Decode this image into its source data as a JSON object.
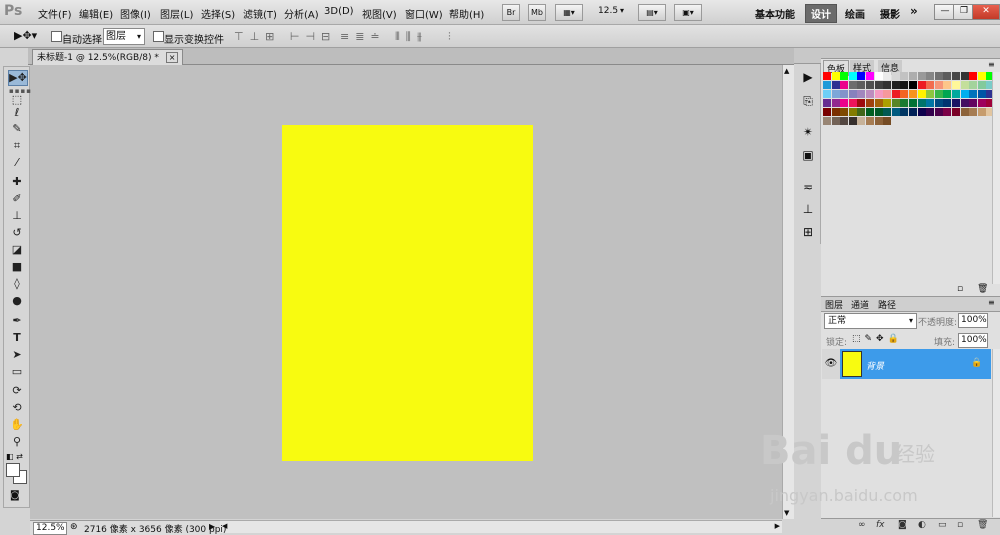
{
  "app": {
    "logo": "Ps"
  },
  "menu": [
    "文件(F)",
    "编辑(E)",
    "图像(I)",
    "图层(L)",
    "选择(S)",
    "滤镜(T)",
    "分析(A)",
    "3D(D)",
    "视图(V)",
    "窗口(W)",
    "帮助(H)"
  ],
  "menu_buttons": {
    "bridge": "Br",
    "minibridge": "Mb",
    "zoom_value": "12.5"
  },
  "workspaces": {
    "essentials": "基本功能",
    "design": "设计",
    "painting": "绘画",
    "photography": "摄影",
    "more": "»"
  },
  "options": {
    "auto_select_label": "自动选择:",
    "auto_select_target": "图层",
    "show_transform_label": "显示变换控件"
  },
  "document": {
    "tab_title": "未标题-1 @ 12.5%(RGB/8) *",
    "close": "×",
    "fill_color": "#f8fb10"
  },
  "status": {
    "zoom": "12.5%",
    "doc_info": "2716 像素 x 3656 像素 (300 ppi)"
  },
  "swatches_panel": {
    "tabs": [
      "色板",
      "样式",
      "信息"
    ]
  },
  "layers_panel": {
    "tabs": [
      "图层",
      "通道",
      "路径"
    ],
    "blend_mode": "正常",
    "opacity_label": "不透明度:",
    "opacity_value": "100%",
    "lock_label": "锁定:",
    "fill_label": "填充:",
    "fill_value": "100%",
    "layer_name": "背景"
  },
  "watermark": {
    "brand": "Bai du",
    "cn": "经验",
    "url": "jingyan.baidu.com"
  },
  "colors": {
    "canvas_fill": "#f8fb10",
    "selected_layer": "#3d9bea"
  },
  "icons": [
    "move-tool-icon",
    "marquee-tool-icon",
    "lasso-tool-icon",
    "quick-select-icon",
    "crop-tool-icon",
    "eyedropper-icon",
    "healing-brush-icon",
    "brush-icon",
    "clone-stamp-icon",
    "history-brush-icon",
    "eraser-icon",
    "gradient-icon",
    "blur-icon",
    "dodge-icon",
    "pen-icon",
    "type-icon",
    "path-select-icon",
    "shape-icon",
    "3d-rotate-icon",
    "3d-orbit-icon",
    "hand-icon",
    "zoom-icon"
  ]
}
